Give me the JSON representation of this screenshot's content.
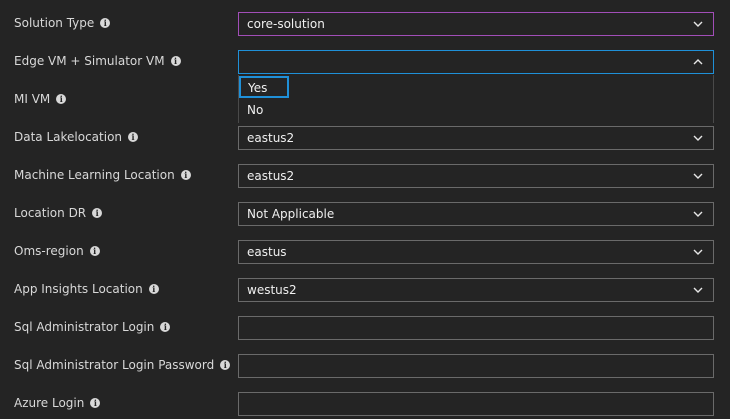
{
  "fields": [
    {
      "label": "Solution Type",
      "value": "core-solution",
      "kind": "select"
    },
    {
      "label": "Edge VM + Simulator VM",
      "value": "",
      "kind": "select-open"
    },
    {
      "label": "MI VM",
      "value": "",
      "kind": "hidden"
    },
    {
      "label": "Data Lakelocation",
      "value": "eastus2",
      "kind": "select"
    },
    {
      "label": "Machine Learning Location",
      "value": "eastus2",
      "kind": "select"
    },
    {
      "label": "Location DR",
      "value": "Not Applicable",
      "kind": "select"
    },
    {
      "label": "Oms-region",
      "value": "eastus",
      "kind": "select"
    },
    {
      "label": "App Insights Location",
      "value": "westus2",
      "kind": "select"
    },
    {
      "label": "Sql Administrator Login",
      "value": "",
      "kind": "text"
    },
    {
      "label": "Sql Administrator Login Password",
      "value": "",
      "kind": "text"
    },
    {
      "label": "Azure Login",
      "value": "",
      "kind": "text"
    }
  ],
  "dropdown": {
    "options": [
      "Yes",
      "No"
    ],
    "focused": "Yes"
  },
  "colors": {
    "background": "#242424",
    "active_border": "#a24eb8",
    "open_border": "#1f90d8",
    "field_border": "#6a6a6a"
  },
  "icons": {
    "info": "info-icon",
    "chevron_down": "chevron-down-icon",
    "chevron_up": "chevron-up-icon"
  }
}
